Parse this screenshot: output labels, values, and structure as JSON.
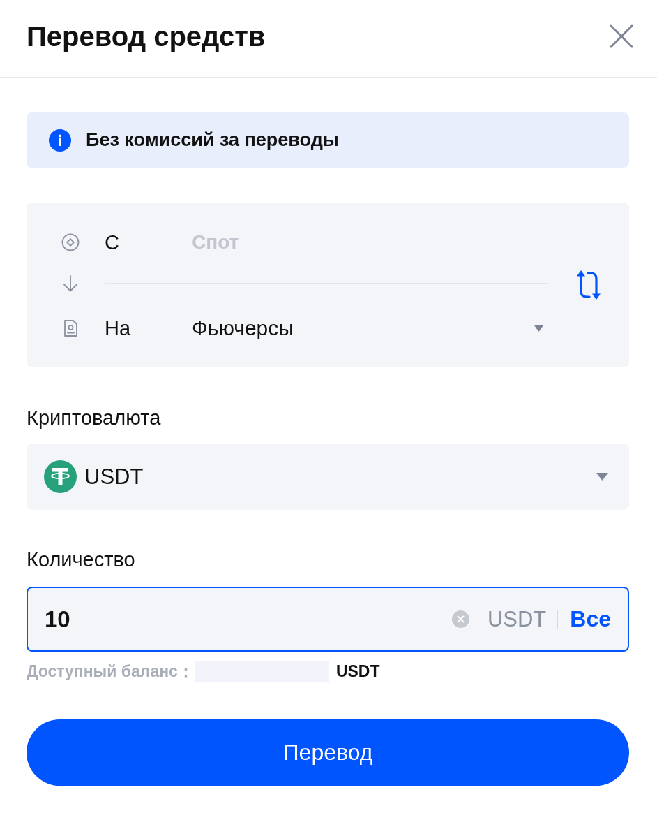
{
  "header": {
    "title": "Перевод средств"
  },
  "notice": {
    "text": "Без комиссий за переводы"
  },
  "transfer": {
    "rows": [
      {
        "kind": "from",
        "label": "С",
        "value": "Спот",
        "disabled": true
      },
      {
        "kind": "to",
        "label": "На",
        "value": "Фьючерсы",
        "disabled": false
      }
    ]
  },
  "currency": {
    "label": "Криптовалюта",
    "value": "USDT"
  },
  "amount": {
    "label": "Количество",
    "value": "10",
    "unit": "USDT",
    "max_button": "Все",
    "focused": true
  },
  "balance": {
    "label": "Доступный баланс：",
    "value": "USDT",
    "redacted": true
  },
  "submit_button": "Перевод"
}
